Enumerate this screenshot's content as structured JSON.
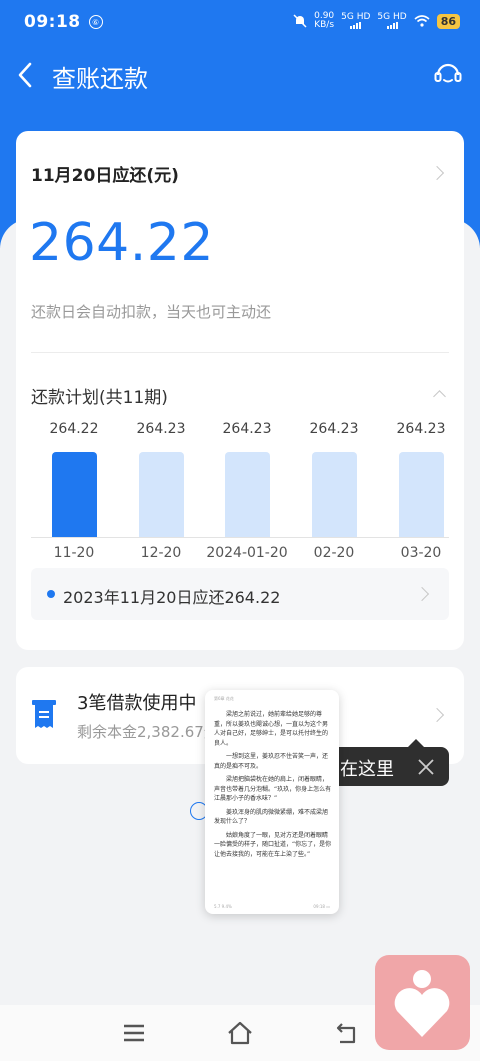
{
  "status_bar": {
    "time": "09:18",
    "net_speed_value": "0.90",
    "net_speed_unit": "KB/s",
    "sim1": "5G HD",
    "sim2": "5G HD",
    "battery": "86"
  },
  "header": {
    "title": "查账还款"
  },
  "due_card": {
    "title": "11月20日应还(元)",
    "amount": "264.22",
    "note": "还款日会自动扣款，当天也可主动还"
  },
  "plan": {
    "title": "还款计划(共11期)",
    "summary": "2023年11月20日应还264.22"
  },
  "chart_data": {
    "type": "bar",
    "categories": [
      "11-20",
      "12-20",
      "2024-01-20",
      "02-20",
      "03-20"
    ],
    "values": [
      264.22,
      264.23,
      264.23,
      264.23,
      264.23
    ],
    "value_labels": [
      "264.22",
      "264.23",
      "264.23",
      "264.23",
      "264.23"
    ],
    "highlight_index": 0,
    "colors": {
      "highlight": "#1f78f0",
      "normal": "#d3e5fc"
    },
    "grid": false
  },
  "loans": {
    "title": "3笔借款使用中",
    "subtitle": "剩余本金2,382.67元"
  },
  "toast": {
    "text": "在这里"
  },
  "reader": {
    "top": "第6章  花花",
    "paragraphs": [
      "梁旭之前说过，她前辈给她足够的尊重，所以姜玖也飓诚心想，一直以为这个男人对自己好，足够绅士，是可以托付终生的良人。",
      "一想到这里，姜玖忍不住苦笑一声，还真的是痴不可及。",
      "梁旭把脑袋枕在她的肩上，闭着眼睛，声音也带着几分泡糊。“玖玖，你身上怎么有江晨那小子的香水味？”",
      "姜玖浑身的肌肉微微紧绷，难不成梁旭发现什么了？",
      "姑娘角度了一眼，见对方还是闭着眼睛一脸慵受的样子，随口扯道，“你忘了，是你让他去接我的，可能在车上染了些。”"
    ],
    "foot_left": "5.7  9.4%",
    "foot_right": "09:18 ▭"
  },
  "icons": {
    "back": "back-arrow-icon",
    "support": "customer-service-icon",
    "loan": "receipt-icon",
    "close": "close-icon",
    "menu": "menu-icon",
    "home": "home-icon",
    "nav_back": "return-icon",
    "float_app": "heart-person-icon"
  },
  "colors": {
    "brand": "#1f78f0",
    "background": "#f2f3f5",
    "float_app": "#f0a6a8"
  }
}
